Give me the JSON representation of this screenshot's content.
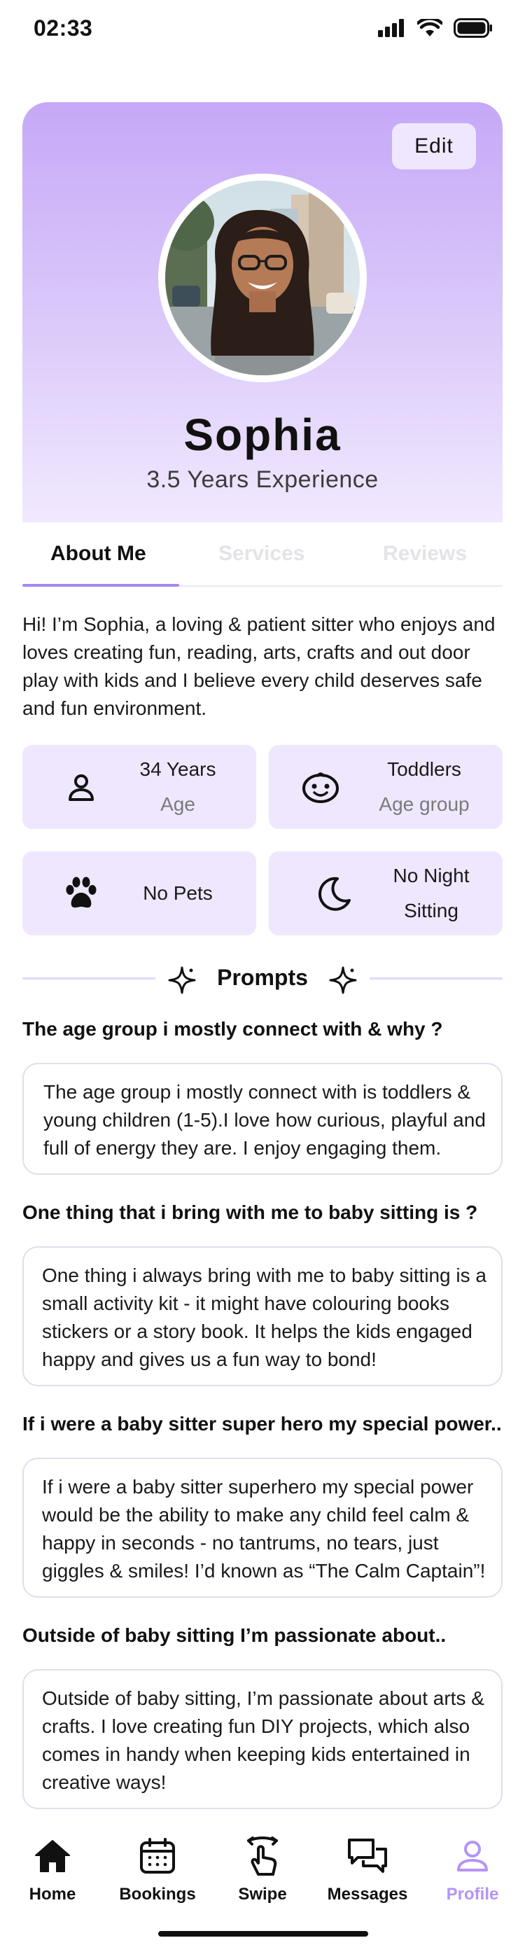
{
  "status": {
    "time": "02:33"
  },
  "profile": {
    "edit_label": "Edit",
    "name": "Sophia",
    "experience": "3.5 Years Experience"
  },
  "tabs": [
    {
      "label": "About Me"
    },
    {
      "label": "Services"
    },
    {
      "label": "Reviews"
    }
  ],
  "bio": "Hi! I’m Sophia, a loving & patient sitter who enjoys and loves creating fun, reading, arts, crafts and out door play with kids and I believe every child deserves safe and fun environment.",
  "info_cards": [
    {
      "icon": "person-icon",
      "value": "34 Years",
      "label": "Age"
    },
    {
      "icon": "baby-face-icon",
      "value": "Toddlers",
      "label": "Age group"
    },
    {
      "icon": "paw-icon",
      "value": "No Pets",
      "label": ""
    },
    {
      "icon": "moon-icon",
      "value": "No Night Sitting",
      "label": ""
    }
  ],
  "prompts_title": "Prompts",
  "prompts": [
    {
      "question": "The age group i mostly connect with & why ?",
      "answer": "The age group i mostly connect with is toddlers & young children (1-5).I love how curious, playful and full of energy they are. I enjoy engaging them."
    },
    {
      "question": "One thing that i bring with me to baby sitting is ?",
      "answer": "One thing i always bring with me to baby sitting is a small activity kit - it might have colouring books stickers or a story book. It helps the kids engaged happy and gives us a fun way to bond!"
    },
    {
      "question": "If i were a baby sitter super hero my special power..",
      "answer": "If i were a baby sitter superhero my special power would be the ability to make any child feel calm & happy in seconds - no tantrums, no tears, just giggles & smiles! I’d known as “The Calm Captain”!"
    },
    {
      "question": "Outside of baby sitting I’m passionate about..",
      "answer": "Outside of baby sitting, I’m passionate about arts & crafts. I love creating fun DIY projects, which also comes in handy when keeping kids entertained in creative ways!"
    }
  ],
  "nav": [
    {
      "label": "Home",
      "icon": "home-icon"
    },
    {
      "label": "Bookings",
      "icon": "calendar-icon"
    },
    {
      "label": "Swipe",
      "icon": "swipe-hand-icon"
    },
    {
      "label": "Messages",
      "icon": "chat-bubbles-icon"
    },
    {
      "label": "Profile",
      "icon": "profile-icon",
      "active": true
    }
  ],
  "colors": {
    "accent": "#a687f3",
    "hero_top": "#c6a8f7",
    "card_bg": "#efe7fd",
    "active_nav": "#b594f5"
  }
}
